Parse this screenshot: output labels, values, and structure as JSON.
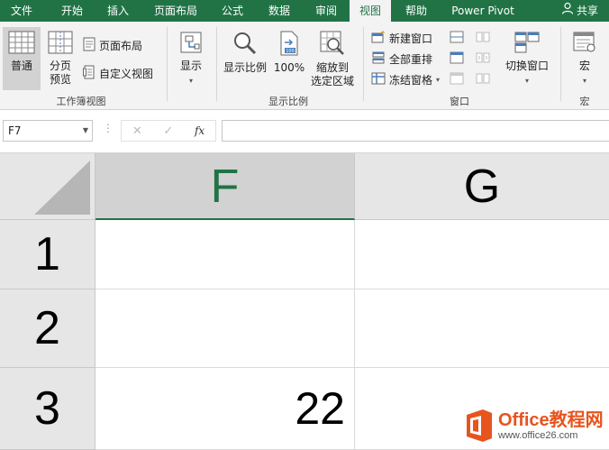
{
  "tabs": [
    "文件",
    "开始",
    "插入",
    "页面布局",
    "公式",
    "数据",
    "审阅",
    "视图",
    "帮助",
    "Power Pivot"
  ],
  "active_tab": "视图",
  "share_label": "共享",
  "ribbon": {
    "workbook_views": {
      "normal": "普通",
      "page_break_1": "分页",
      "page_break_2": "预览",
      "page_layout": "页面布局",
      "custom_views": "自定义视图",
      "group_label": "工作簿视图"
    },
    "show": {
      "label": "显示"
    },
    "zoom": {
      "zoom": "显示比例",
      "hundred": "100%",
      "zoom_sel_1": "缩放到",
      "zoom_sel_2": "选定区域",
      "group_label": "显示比例"
    },
    "window": {
      "new_window": "新建窗口",
      "arrange_all": "全部重排",
      "freeze_panes": "冻结窗格",
      "switch_windows": "切换窗口",
      "group_label": "窗口"
    },
    "macros": {
      "label": "宏",
      "group_label": "宏"
    }
  },
  "formula_bar": {
    "name_box": "F7",
    "cancel": "✕",
    "enter": "✓",
    "fx": "fx",
    "formula": ""
  },
  "sheet": {
    "columns": [
      "F",
      "G"
    ],
    "selected_column": "F",
    "rows": [
      "1",
      "2",
      "3"
    ],
    "cells": {
      "F1": "",
      "G1": "",
      "F2": "",
      "G2": "",
      "F3": "22",
      "G3": ""
    }
  },
  "watermark": {
    "line1": "Office教程网",
    "line2": "www.office26.com"
  },
  "colors": {
    "excel_green": "#217346",
    "ribbon_bg": "#f3f3f3",
    "header_bg": "#e6e6e6",
    "watermark_orange": "#e8541e"
  }
}
